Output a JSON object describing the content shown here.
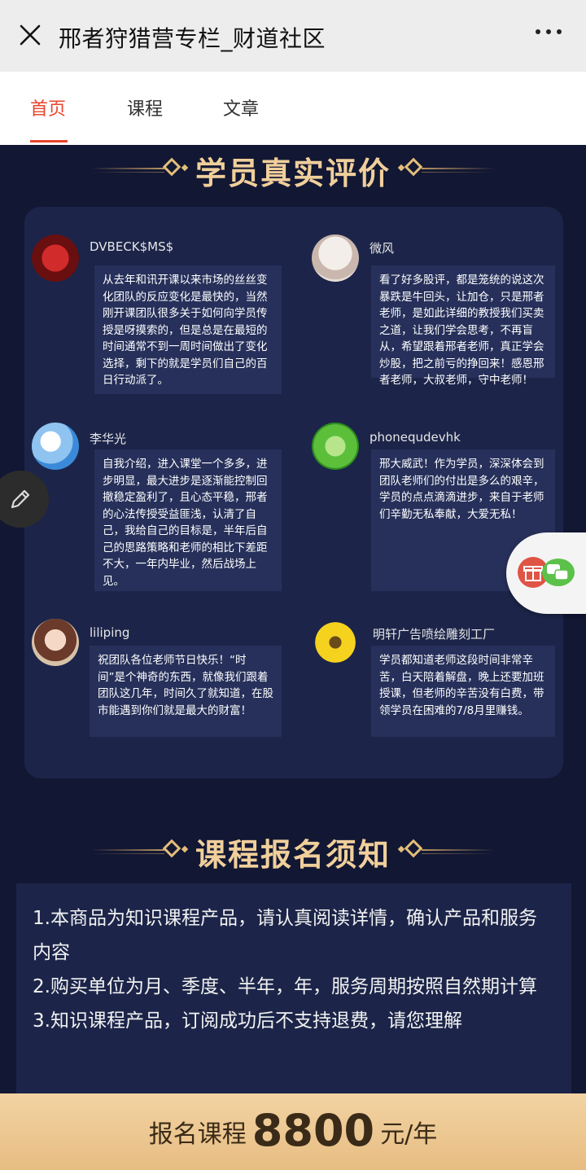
{
  "topbar": {
    "title": "邢者狩猎营专栏_财道社区",
    "close_icon": "close-icon",
    "more_icon": "more-dots-icon"
  },
  "tabs": [
    {
      "label": "首页",
      "active": true
    },
    {
      "label": "课程",
      "active": false
    },
    {
      "label": "文章",
      "active": false
    }
  ],
  "reviews_heading": "学员真实评价",
  "reviews": [
    {
      "name": "DVBECK$MS$",
      "text": "从去年和讯开课以来市场的丝丝变化团队的反应变化是最快的，当然刚开课团队很多关于如何向学员传授是呀摸索的，但是总是在最短的时间通常不到一周时间做出了变化选择，剩下的就是学员们自己的百日行动派了。"
    },
    {
      "name": "微风",
      "text": "看了好多股评，都是笼统的说这次暴跌是牛回头，让加仓，只是邢者老师，是如此详细的教授我们买卖之道，让我们学会思考，不再盲从，希望跟着邢者老师，真正学会炒股，把之前亏的挣回来！感恩邢者老师，大叔老师，守中老师！"
    },
    {
      "name": "李华光",
      "text": "自我介绍，进入课堂一个多多，进步明显，最大进步是逐渐能控制回撤稳定盈利了，且心态平稳，邢者的心法传授受益匪浅，认清了自己，我给自己的目标是，半年后自己的思路策略和老师的相比下差距不大，一年内毕业，然后战场上见。"
    },
    {
      "name": "phonequdevhk",
      "text": "邢大威武！作为学员，深深体会到团队老师们的付出是多么的艰辛，学员的点点滴滴进步，来自于老师们辛勤无私奉献，大爱无私！"
    },
    {
      "name": "liliping",
      "text": "祝团队各位老师节日快乐！“时间”是个神奇的东西，就像我们跟着团队这几年，时间久了就知道，在股市能遇到你们就是最大的财富！"
    },
    {
      "name": "明轩广告喷绘雕刻工厂",
      "text": "学员都知道老师这段时间非常辛苦，白天陪着解盘，晚上还要加班授课，但老师的辛苦没有白费，带领学员在困难的7/8月里赚钱。"
    }
  ],
  "notice_heading": "课程报名须知",
  "notice_items": [
    "1.本商品为知识课程产品，请认真阅读详情，确认产品和服务内容",
    "2.购买单位为月、季度、半年，年，服务周期按照自然期计算",
    "3.知识课程产品，订阅成功后不支持退费，请您理解"
  ],
  "bottom": {
    "label": "报名课程",
    "price": "8800",
    "unit": "元/年"
  },
  "colors": {
    "accent": "#e8452e",
    "gold": "#f0cf9b",
    "bg": "#121733",
    "panel": "#1c2549"
  }
}
